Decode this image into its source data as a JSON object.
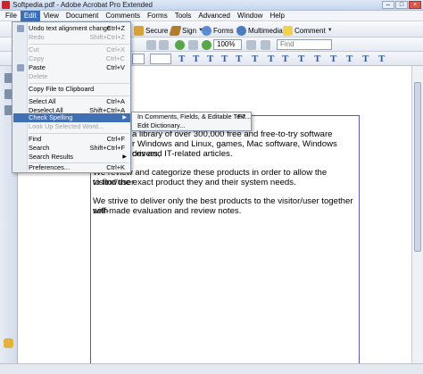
{
  "window": {
    "title": "Softpedia.pdf - Adobe Acrobat Pro Extended"
  },
  "menubar": [
    {
      "label": "File"
    },
    {
      "label": "Edit"
    },
    {
      "label": "View"
    },
    {
      "label": "Document"
    },
    {
      "label": "Comments"
    },
    {
      "label": "Forms"
    },
    {
      "label": "Tools"
    },
    {
      "label": "Advanced"
    },
    {
      "label": "Window"
    },
    {
      "label": "Help"
    }
  ],
  "active_menu": "Edit",
  "toolbar": {
    "secure": "Secure",
    "sign": "Sign",
    "forms": "Forms",
    "multimedia": "Multimedia",
    "comment": "Comment",
    "zoom": "100%",
    "find_placeholder": "Find"
  },
  "document": {
    "paragraphs": [
      "a library of over 300,000 free and free-to-try software",
      "r Windows and Linux, games, Mac software, Windows drivers,",
      "ces and IT-related articles.",
      "We review and categorize these products in order to allow the visitor/user",
      "to find the exact product they and their system needs.",
      "We strive to deliver only the best products to the visitor/user together with",
      "self-made evaluation and review notes."
    ]
  },
  "edit_menu": {
    "items": [
      {
        "label": "Undo text alignment change",
        "shortcut": "Ctrl+Z",
        "disabled": false
      },
      {
        "label": "Redo",
        "shortcut": "Shift+Ctrl+Z",
        "disabled": true
      },
      {
        "label": "Cut",
        "shortcut": "Ctrl+X",
        "disabled": true
      },
      {
        "label": "Copy",
        "shortcut": "Ctrl+C",
        "disabled": true
      },
      {
        "label": "Paste",
        "shortcut": "Ctrl+V",
        "disabled": false
      },
      {
        "label": "Delete",
        "shortcut": "",
        "disabled": true
      },
      {
        "label": "Copy File to Clipboard",
        "shortcut": "",
        "disabled": false
      },
      {
        "label": "Select All",
        "shortcut": "Ctrl+A",
        "disabled": false
      },
      {
        "label": "Deselect All",
        "shortcut": "Shift+Ctrl+A",
        "disabled": false
      },
      {
        "label": "Check Spelling",
        "shortcut": "",
        "disabled": false
      },
      {
        "label": "Look Up Selected Word...",
        "shortcut": "",
        "disabled": true
      },
      {
        "label": "Find",
        "shortcut": "Ctrl+F",
        "disabled": false
      },
      {
        "label": "Search",
        "shortcut": "Shift+Ctrl+F",
        "disabled": false
      },
      {
        "label": "Search Results",
        "shortcut": "",
        "disabled": false
      },
      {
        "label": "Preferences...",
        "shortcut": "Ctrl+K",
        "disabled": false
      }
    ]
  },
  "spelling_submenu": {
    "items": [
      {
        "label": "In Comments, Fields, & Editable Text...",
        "shortcut": "F7"
      },
      {
        "label": "Edit Dictionary..."
      }
    ]
  },
  "colors": {
    "accent": "#3f6fb5",
    "page_border": "#5a5ab0"
  }
}
